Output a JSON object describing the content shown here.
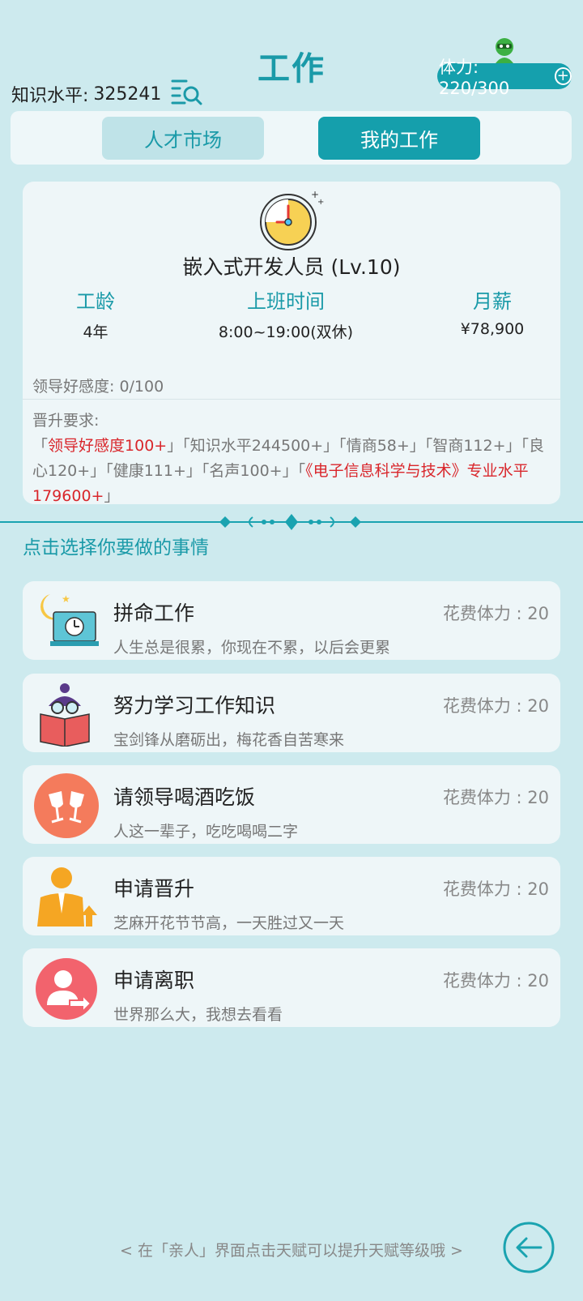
{
  "header": {
    "title": "工作",
    "knowledge_label": "知识水平:",
    "knowledge_value": "325241",
    "energy": "体力: 220/300",
    "energy_plus": "+"
  },
  "tabs": [
    {
      "label": "人才市场",
      "active": false
    },
    {
      "label": "我的工作",
      "active": true
    }
  ],
  "job": {
    "title": "嵌入式开发人员 (Lv.10)",
    "years_label": "工龄",
    "years_value": "4年",
    "hours_label": "上班时间",
    "hours_value": "8:00~19:00(双休)",
    "salary_label": "月薪",
    "salary_value": "¥78,900",
    "favor": "领导好感度: 0/100",
    "promo_label": "晋升要求:",
    "req": {
      "r1": "领导好感度100+",
      "r2": "知识水平244500+",
      "r3": "情商58+",
      "r4": "智商112+",
      "r5": "良心120+",
      "r6": "健康111+",
      "r7": "名声100+",
      "r8": "《电子信息科学与技术》专业水平179600+"
    }
  },
  "prompt": "点击选择你要做的事情",
  "actions": [
    {
      "name": "拼命工作",
      "cost": "花费体力 : 20",
      "desc": "人生总是很累，你现在不累，以后会更累"
    },
    {
      "name": "努力学习工作知识",
      "cost": "花费体力 : 20",
      "desc": "宝剑锋从磨砺出，梅花香自苦寒来"
    },
    {
      "name": "请领导喝酒吃饭",
      "cost": "花费体力 : 20",
      "desc": "人这一辈子，吃吃喝喝二字"
    },
    {
      "name": "申请晋升",
      "cost": "花费体力 : 20",
      "desc": "芝麻开花节节高，一天胜过又一天"
    },
    {
      "name": "申请离职",
      "cost": "花费体力 : 20",
      "desc": "世界那么大，我想去看看"
    }
  ],
  "hint": "< 在「亲人」界面点击天赋可以提升天赋等级哦 >",
  "colors": {
    "accent": "#159fac",
    "background": "#cdeaee",
    "highlight_red": "#d9262b"
  }
}
